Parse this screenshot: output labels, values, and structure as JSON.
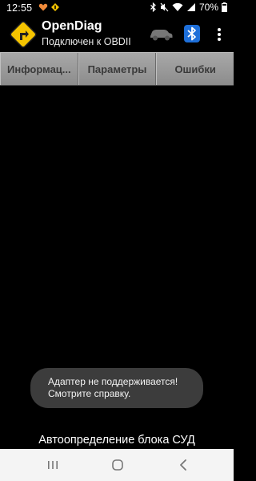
{
  "status_bar": {
    "time": "12:55",
    "battery_percent": "70%",
    "icons": [
      "heart-notification-icon",
      "diamond-notification-icon",
      "bluetooth-icon",
      "mute-icon",
      "wifi-icon",
      "signal-icon",
      "battery-icon"
    ]
  },
  "app_bar": {
    "title": "OpenDiag",
    "subtitle": "Подключен к OBDII",
    "icons": [
      "app-logo-icon",
      "car-icon",
      "bluetooth-icon",
      "overflow-menu-icon"
    ]
  },
  "tabs": [
    {
      "label": "Информац..."
    },
    {
      "label": "Параметры"
    },
    {
      "label": "Ошибки"
    }
  ],
  "toast": {
    "line1": "Адаптер не поддерживается!",
    "line2": "Смотрите справку."
  },
  "bottom_status": "Автоопределение блока СУД",
  "colors": {
    "logo_yellow": "#f5c400",
    "bluetooth_blue": "#1e6fd9",
    "tab_bg": "#9a9a9a",
    "toast_bg": "#3c3c3c",
    "nav_bar_bg": "#f4f4f4"
  },
  "nav_bar": {
    "icons": [
      "recent-apps-icon",
      "home-icon",
      "back-icon"
    ]
  }
}
